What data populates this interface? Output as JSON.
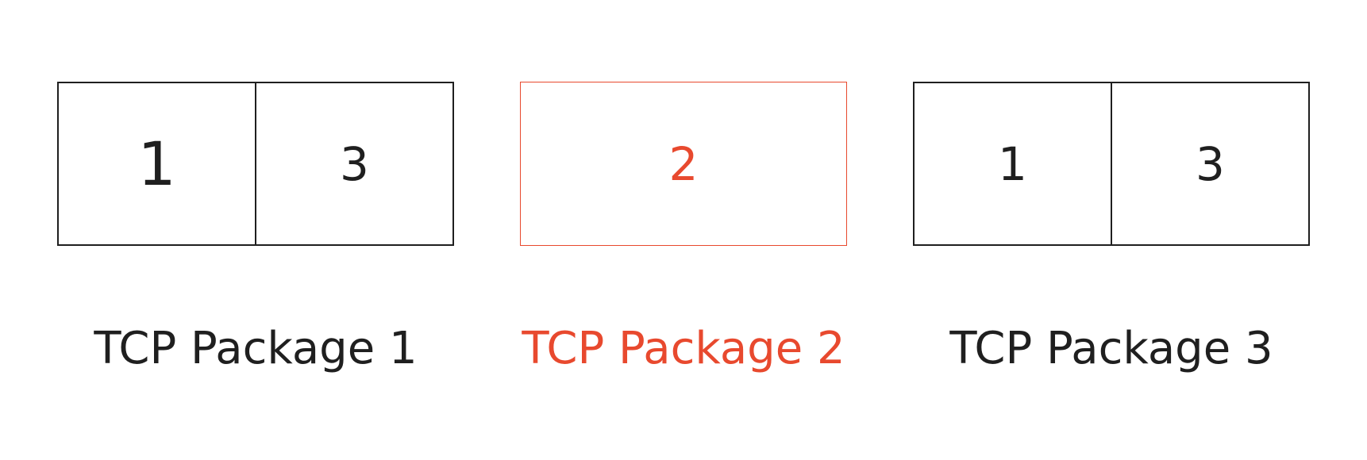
{
  "colors": {
    "black": "#1f1f1f",
    "accent": "#e8492e",
    "background": "#ffffff"
  },
  "packages": [
    {
      "label": "TCP Package 1",
      "segments": [
        "1",
        "3"
      ],
      "highlighted": false
    },
    {
      "label": "TCP Package 2",
      "segments": [
        "2"
      ],
      "highlighted": true
    },
    {
      "label": "TCP Package 3",
      "segments": [
        "1",
        "3"
      ],
      "highlighted": false
    }
  ]
}
